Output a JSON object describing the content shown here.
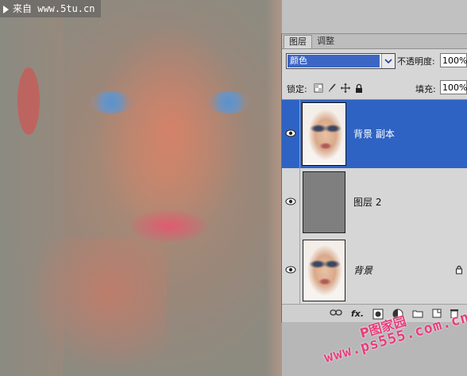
{
  "watermark_top": "来自 www.5tu.cn",
  "panel": {
    "tabs": [
      {
        "label": "图层",
        "active": true
      },
      {
        "label": "调整",
        "active": false
      }
    ],
    "blend_mode": "颜色",
    "opacity_label": "不透明度:",
    "opacity_value": "100%",
    "lock_label": "锁定:",
    "fill_label": "填充:",
    "fill_value": "100%",
    "layers": [
      {
        "name": "背景 副本",
        "selected": true,
        "visible": true,
        "thumb": "face"
      },
      {
        "name": "图层 2",
        "selected": false,
        "visible": true,
        "thumb": "gray"
      },
      {
        "name": "背景",
        "selected": false,
        "visible": true,
        "thumb": "face",
        "locked": true
      }
    ],
    "bottom_icons": [
      "link-icon",
      "fx-icon",
      "mask-icon",
      "adjustment-icon",
      "folder-icon",
      "new-layer-icon",
      "trash-icon"
    ],
    "fx_label": "fx."
  },
  "watermark_bottom": {
    "line1": "P图家园",
    "line2": "www.ps555.com.cn"
  },
  "colors": {
    "selection": "#2f63c3",
    "watermark": "#e83c7b"
  }
}
